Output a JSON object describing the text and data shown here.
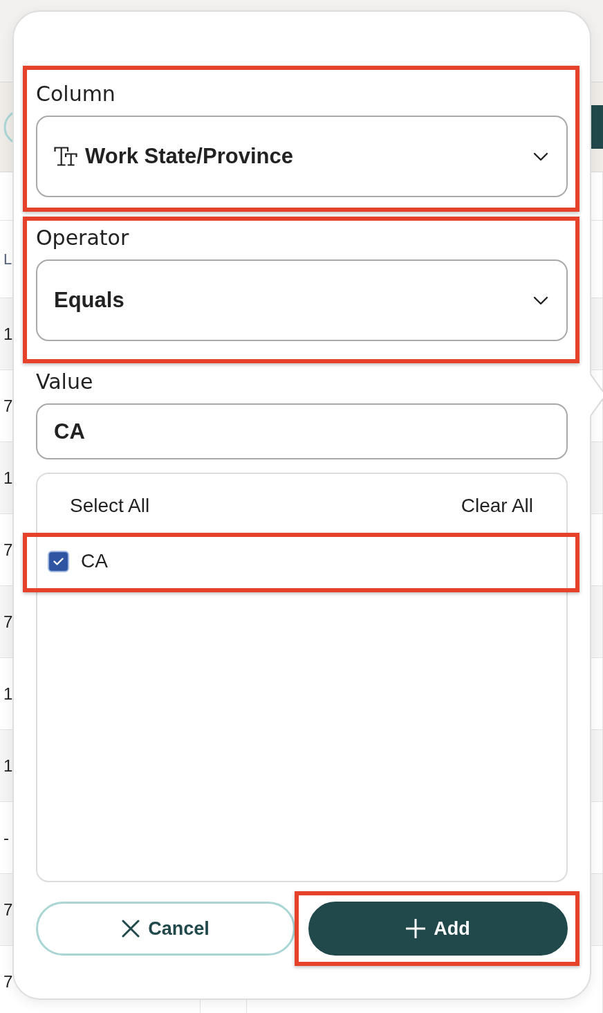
{
  "page": {
    "table": {
      "header": "L",
      "rows": [
        "1",
        "7",
        "1",
        "7",
        "7",
        "1",
        "1",
        "-",
        "7",
        "7"
      ]
    }
  },
  "filter": {
    "column": {
      "label": "Column",
      "value": "Work State/Province",
      "highlighted": true
    },
    "operator": {
      "label": "Operator",
      "value": "Equals",
      "highlighted": true
    },
    "value": {
      "label": "Value",
      "value": "CA",
      "highlighted": false
    },
    "options_list": {
      "select_all": "Select All",
      "clear_all": "Clear All",
      "options": [
        {
          "label": "CA",
          "checked": true,
          "highlighted": true
        }
      ]
    },
    "buttons": [
      {
        "kind": "cancel",
        "label": "Cancel",
        "highlighted": false
      },
      {
        "kind": "add",
        "label": "Add",
        "highlighted": true
      }
    ]
  }
}
